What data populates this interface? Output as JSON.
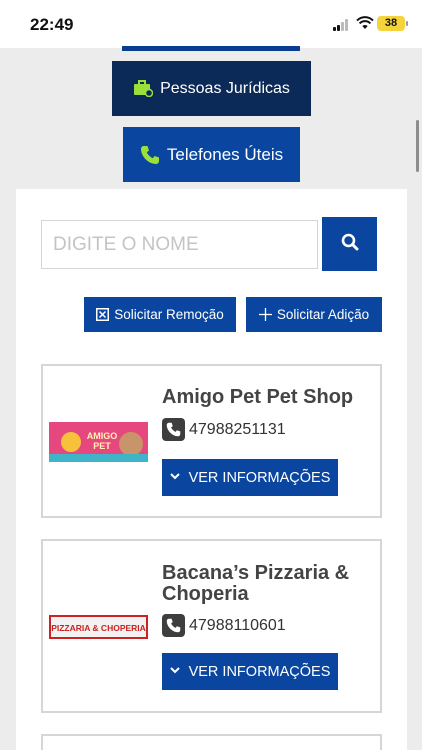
{
  "status_bar": {
    "time": "22:49",
    "battery": "38"
  },
  "categories": {
    "pessoas_juridicas": "Pessoas Jurídicas",
    "telefones_uteis": "Telefones Úteis"
  },
  "search": {
    "placeholder": "DIGITE O NOME"
  },
  "actions": {
    "remove_label": "Solicitar Remoção",
    "add_label": "Solicitar Adição"
  },
  "listings": [
    {
      "name": "Amigo Pet Pet Shop",
      "phone": "47988251131",
      "info_label": "VER INFORMAÇÕES",
      "logo_text": "AMIGO PET"
    },
    {
      "name": "Bacana’s Pizzaria & Choperia",
      "phone": "47988110601",
      "info_label": "VER INFORMAÇÕES",
      "logo_text": "PIZZARIA & CHOPERIA"
    }
  ],
  "colors": {
    "primary": "#0a46a0",
    "dark_navy": "#0c2a57",
    "accent_green": "#9be03a"
  }
}
